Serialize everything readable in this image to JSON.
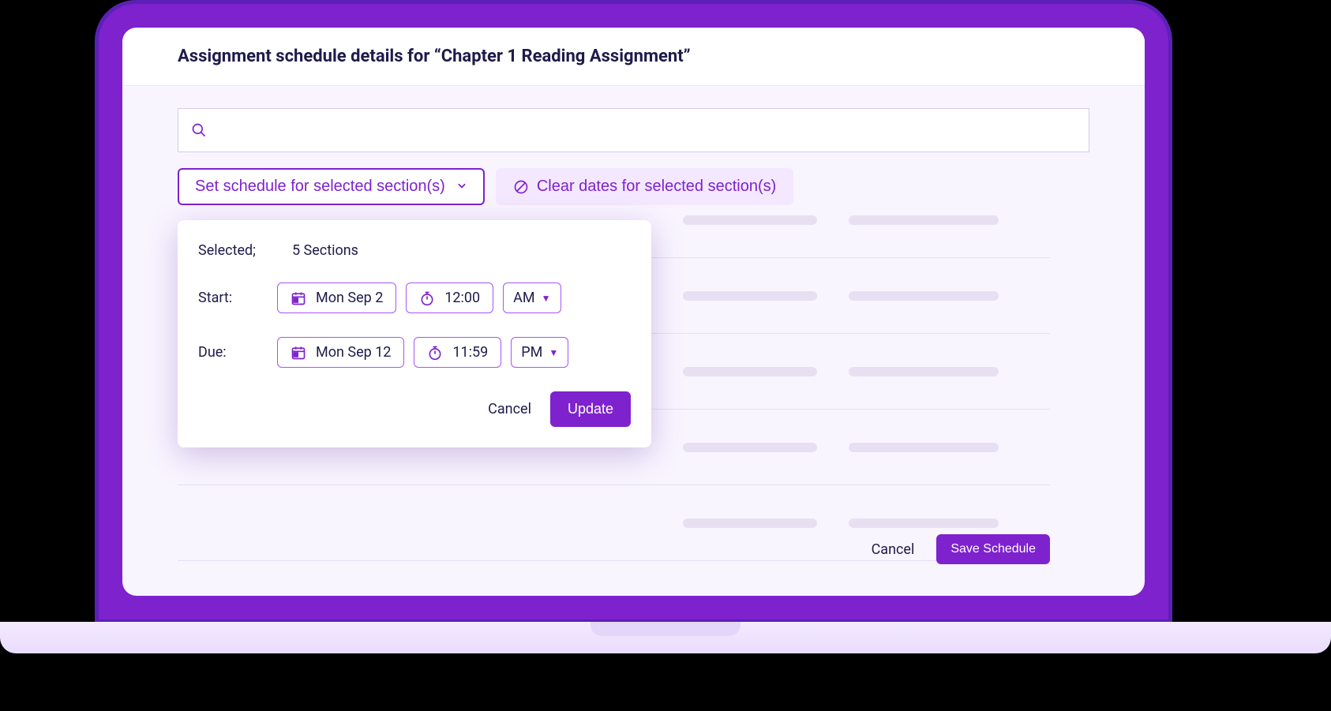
{
  "header": {
    "title": "Assignment schedule details for “Chapter 1 Reading  Assignment”"
  },
  "toolbar": {
    "set_schedule_label": "Set schedule for selected section(s)",
    "clear_dates_label": "Clear dates for selected section(s)"
  },
  "popover": {
    "selected_label": "Selected;",
    "selected_count_text": "5 Sections",
    "rows": [
      {
        "label": "Start:",
        "date": "Mon Sep 2",
        "time": "12:00",
        "ampm": "AM"
      },
      {
        "label": "Due:",
        "date": "Mon Sep 12",
        "time": "11:59",
        "ampm": "PM"
      }
    ],
    "actions": {
      "cancel": "Cancel",
      "update": "Update"
    }
  },
  "footer": {
    "cancel": "Cancel",
    "save": "Save Schedule"
  },
  "colors": {
    "accent": "#7e22ce",
    "text": "#1e1b4b",
    "panel_bg": "#f9f5ff"
  }
}
